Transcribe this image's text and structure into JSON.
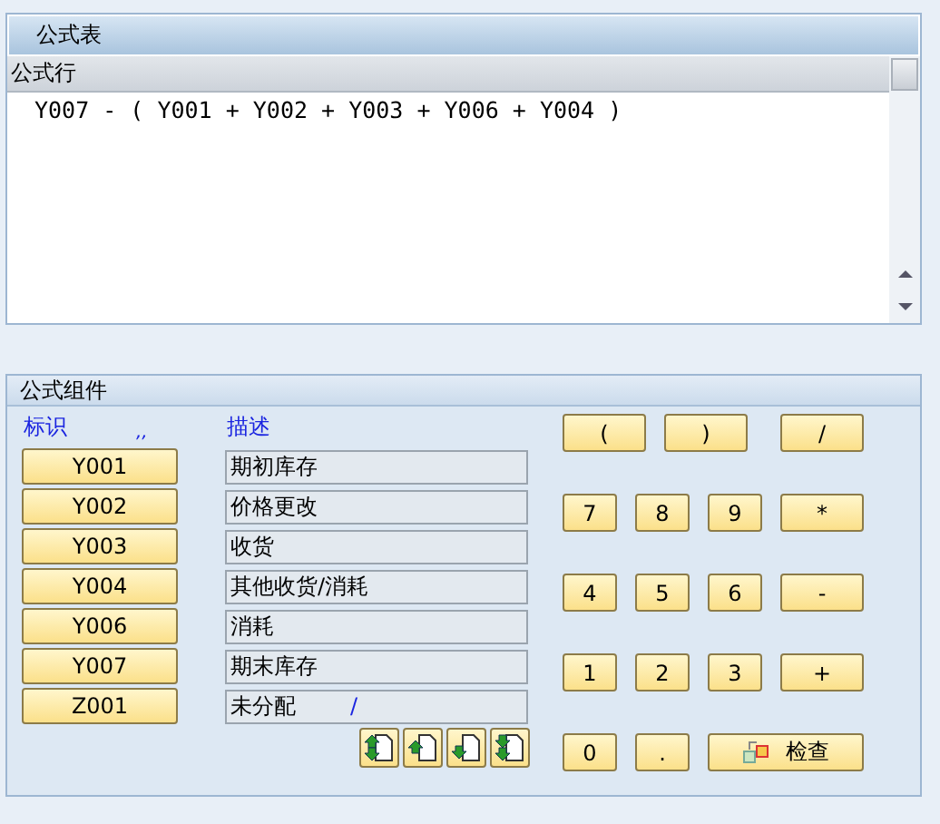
{
  "formula_table": {
    "title": "公式表",
    "column_header": "公式行",
    "formula": "Y007 - ( Y001 + Y002 + Y003 + Y006 + Y004 )"
  },
  "components": {
    "title": "公式组件",
    "id_header": "标识",
    "marker": ",,",
    "desc_header": "描述",
    "rows": [
      {
        "id": "Y001",
        "description": "期初库存"
      },
      {
        "id": "Y002",
        "description": "价格更改"
      },
      {
        "id": "Y003",
        "description": "收货"
      },
      {
        "id": "Y004",
        "description": "其他收货/消耗"
      },
      {
        "id": "Y006",
        "description": "消耗"
      },
      {
        "id": "Y007",
        "description": "期末库存"
      },
      {
        "id": "Z001",
        "description": "未分配",
        "note": "/"
      }
    ],
    "move_buttons": [
      {
        "kind": "top"
      },
      {
        "kind": "up"
      },
      {
        "kind": "down"
      },
      {
        "kind": "bottom"
      }
    ],
    "keypad": [
      [
        {
          "label": "(",
          "kind": "paren"
        },
        {
          "label": ")",
          "kind": "paren"
        },
        {
          "label": "/",
          "kind": "op"
        }
      ],
      [
        {
          "label": "7",
          "kind": "digit"
        },
        {
          "label": "8",
          "kind": "digit"
        },
        {
          "label": "9",
          "kind": "digit"
        },
        {
          "label": "*",
          "kind": "op"
        }
      ],
      [
        {
          "label": "4",
          "kind": "digit"
        },
        {
          "label": "5",
          "kind": "digit"
        },
        {
          "label": "6",
          "kind": "digit"
        },
        {
          "label": "-",
          "kind": "op"
        }
      ],
      [
        {
          "label": "1",
          "kind": "digit"
        },
        {
          "label": "2",
          "kind": "digit"
        },
        {
          "label": "3",
          "kind": "digit"
        },
        {
          "label": "+",
          "kind": "op"
        }
      ],
      [
        {
          "label": "0",
          "kind": "digit"
        },
        {
          "label": ".",
          "kind": "digit"
        },
        {
          "label": "检查",
          "kind": "check"
        }
      ]
    ]
  }
}
